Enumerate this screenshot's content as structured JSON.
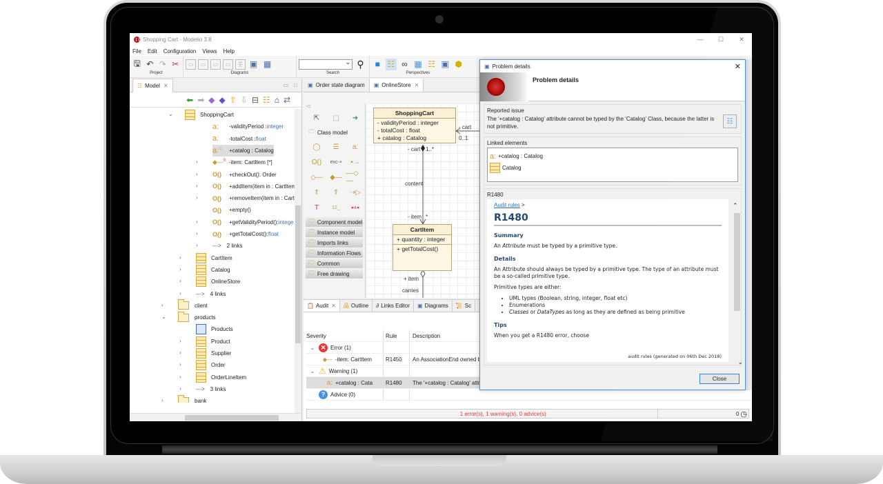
{
  "window": {
    "title": "Shopping Cart - Modelio 3.8",
    "controls": [
      "minimize",
      "maximize",
      "close"
    ]
  },
  "menu": [
    "File",
    "Edit",
    "Configuration",
    "Views",
    "Help"
  ],
  "toolbar": {
    "groups": [
      {
        "label": "Project"
      },
      {
        "label": "Diagrams"
      },
      {
        "label": "Search"
      },
      {
        "label": "Perspectives"
      }
    ],
    "search_value": ""
  },
  "model_panel": {
    "tab_label": "Model",
    "tree": [
      {
        "label": "ShoppingCart",
        "icon": "class-icon",
        "expanded": true
      },
      {
        "label": "-validityPeriod : ",
        "type": "integer",
        "icon": "attribute-icon"
      },
      {
        "label": "-totalCost : ",
        "type": "float",
        "icon": "attribute-icon"
      },
      {
        "label": "+catalog : Catalog",
        "icon": "attribute-warning-icon",
        "selected": true
      },
      {
        "label": "-item: CartItem [*]",
        "icon": "association-end-icon"
      },
      {
        "label": "+checkOut(): Order",
        "icon": "operation-icon"
      },
      {
        "label": "+addItem(item in : CartItem",
        "icon": "operation-icon"
      },
      {
        "label": "+removeItem(item in : Cart",
        "icon": "operation-icon"
      },
      {
        "label": "+empty()",
        "icon": "operation-icon"
      },
      {
        "label": "+getValidityPeriod(): ",
        "type": "intege",
        "icon": "operation-icon"
      },
      {
        "label": "+getTotalCost(): ",
        "type": "float",
        "icon": "operation-icon"
      },
      {
        "label": "2 links",
        "icon": "link-icon"
      },
      {
        "label": "CartItem",
        "icon": "class-icon"
      },
      {
        "label": "Catalog",
        "icon": "class-icon"
      },
      {
        "label": "OnlineStore",
        "icon": "class-icon"
      },
      {
        "label": "4 links",
        "icon": "link-icon"
      },
      {
        "label": "client",
        "icon": "package-icon"
      },
      {
        "label": "products",
        "icon": "package-icon",
        "expanded": true
      },
      {
        "label": "Products",
        "icon": "diagram-icon"
      },
      {
        "label": "Product",
        "icon": "class-icon"
      },
      {
        "label": "Supplier",
        "icon": "class-icon"
      },
      {
        "label": "Order",
        "icon": "class-icon"
      },
      {
        "label": "OrderLineItem",
        "icon": "class-icon"
      },
      {
        "label": "3 links",
        "icon": "link-icon"
      },
      {
        "label": "bank",
        "icon": "package-icon"
      }
    ]
  },
  "editor": {
    "tabs": [
      {
        "label": "Order state diagram",
        "active": false
      },
      {
        "label": "OnlineStore",
        "active": true
      }
    ],
    "palette": {
      "header": "Class model",
      "categories": [
        "Component model",
        "Instance model",
        "Imports links",
        "Information Flows",
        "Common",
        "Free drawing"
      ]
    },
    "diagram": {
      "shopping_cart": {
        "name": "ShoppingCart",
        "attributes": [
          "- validityPeriod : integer",
          "- totalCost : float",
          "+ catalog : Catalog"
        ]
      },
      "cart_item": {
        "name": "CartItem",
        "attributes": [
          "+ quantity : integer"
        ],
        "operations": [
          "+ getTotalCost()"
        ]
      },
      "labels": {
        "cart_right": "- cart",
        "mult_right": "0..1",
        "cart_bottom": "- cart",
        "mult_top": "1..*",
        "content": "content",
        "item": "- item",
        "item_mult": "*",
        "plus_item": "+ item",
        "carries": "carries"
      }
    }
  },
  "audit": {
    "tabs": [
      "Audit",
      "Outline",
      "Links Editor",
      "Diagrams",
      "Sc"
    ],
    "columns": [
      "Severity",
      "Rule",
      "Description"
    ],
    "rows": [
      {
        "severity": "Error (1)",
        "rule": "",
        "description": "",
        "kind": "error-group"
      },
      {
        "severity": "-item: CartItem",
        "rule": "R1450",
        "description": "An AssociationEnd owned by",
        "kind": "item"
      },
      {
        "severity": "Warning (1)",
        "rule": "",
        "description": "",
        "kind": "warning-group"
      },
      {
        "severity": "+catalog : Cata",
        "rule": "R1480",
        "description": "The '+catalog : Catalog' attri",
        "kind": "item",
        "selected": true
      },
      {
        "severity": "Advice (0)",
        "rule": "",
        "description": "",
        "kind": "advice-group"
      }
    ],
    "status": "1 error(s), 1 warning(s), 0 advice(s)",
    "status_count": "0"
  },
  "dialog": {
    "title": "Problem details",
    "heading": "Problem details",
    "reported_issue_label": "Reported issue",
    "reported_issue_text": "The '+catalog : Catalog' attribute cannot be typed by the 'Catalog' Class, because the latter is not primitive.",
    "linked_elements_label": "Linked elements",
    "linked_elements": [
      "+catalog : Catalog",
      "Catalog"
    ],
    "rule_label": "R1480",
    "rule": {
      "breadcrumb": "Audit rules",
      "breadcrumb_sep": ">",
      "id": "R1480",
      "summary_h": "Summary",
      "summary_pre": "An ",
      "summary_em": "Attribute",
      "summary_post": " must be typed by a primitive type.",
      "details_h": "Details",
      "details_p": "An Attribute should always be typed by a primitive type. The type of an attribute must be a so-called primitive type.",
      "primitive_intro": "Primitive types are either:",
      "list": [
        "UML types (Boolean, string, integer, float etc)",
        "Enumerations"
      ],
      "list_last_em1": "Classes",
      "list_last_mid": " or ",
      "list_last_em2": "DataTypes",
      "list_last_post": " as long as they are defined as being primitive",
      "tips_h": "Tips",
      "tips_p": "When you get a R1480 error, choose",
      "footer": "audit rules (generated on 06th Dec 2018)"
    },
    "close_label": "Close"
  }
}
